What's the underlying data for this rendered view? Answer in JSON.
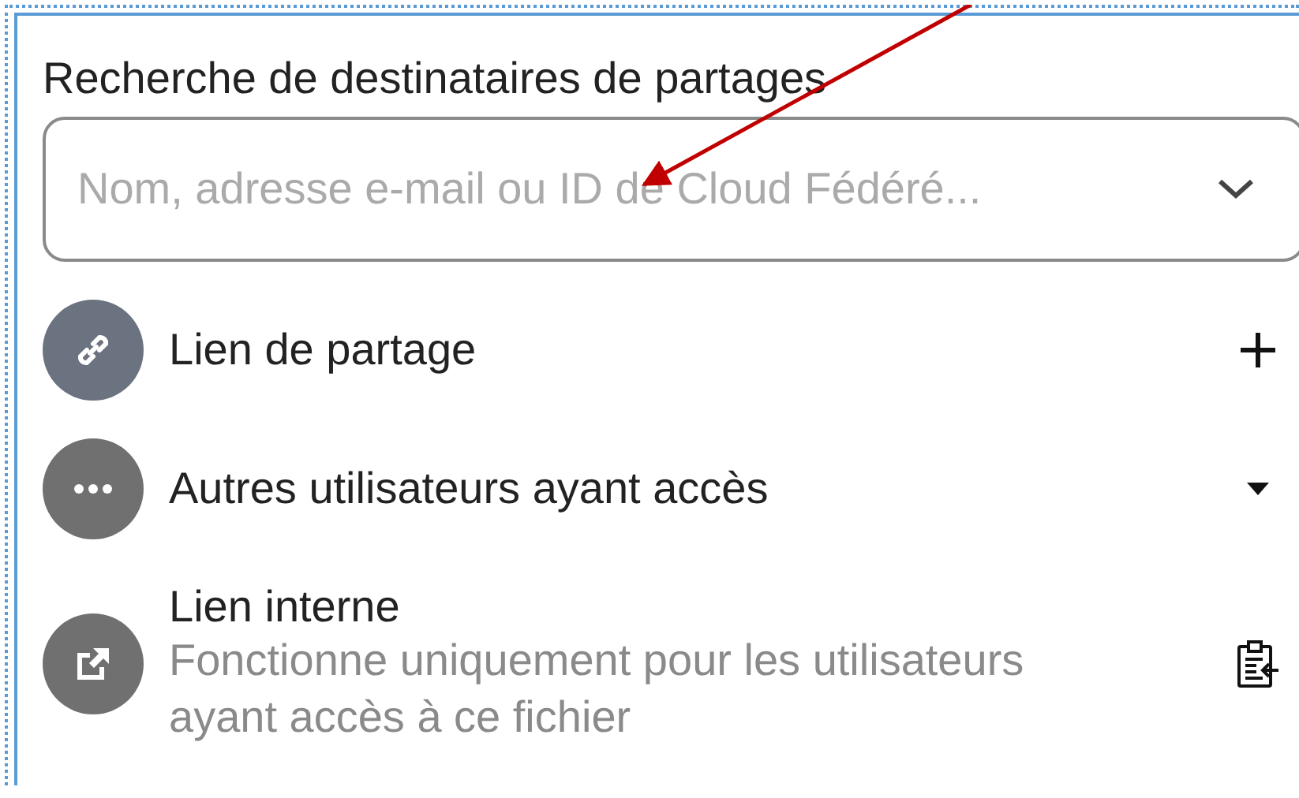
{
  "share_search": {
    "label": "Recherche de destinataires de partages",
    "placeholder": "Nom, adresse e-mail ou ID de Cloud Fédéré..."
  },
  "entries": [
    {
      "kind": "link",
      "title": "Lien de partage"
    },
    {
      "kind": "more",
      "title": "Autres utilisateurs ayant accès"
    },
    {
      "kind": "internal",
      "title": "Lien interne",
      "subtitle": "Fonctionne uniquement pour les utilisateurs ayant accès à ce fichier"
    }
  ]
}
